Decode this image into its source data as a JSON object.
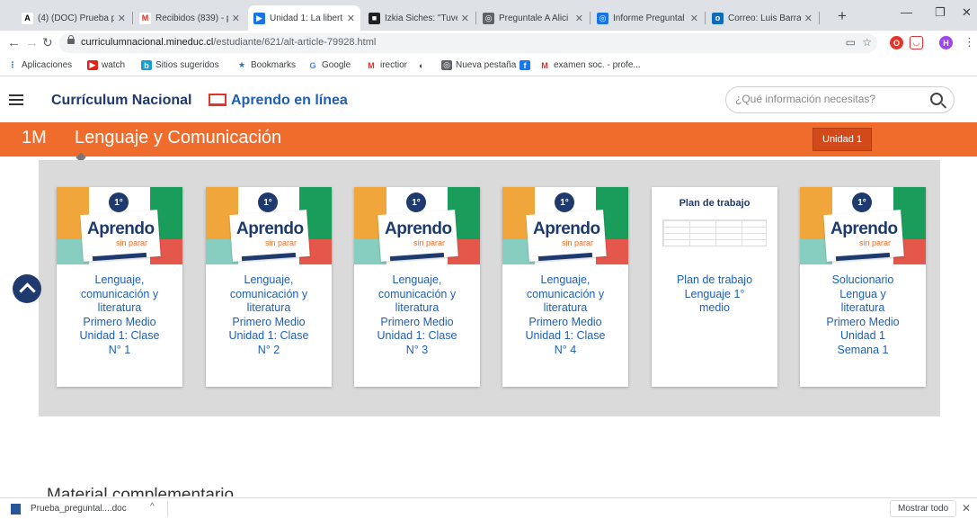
{
  "browser": {
    "tabs": [
      {
        "title": "(4) (DOC) Prueba p",
        "fav": "A",
        "fav_bg": "#ffffff",
        "fav_color": "#000000"
      },
      {
        "title": "Recibidos (839) - p",
        "fav": "M",
        "fav_bg": "#ffffff",
        "fav_color": "#d93025"
      },
      {
        "title": "Unidad 1: La libert",
        "fav": "▶",
        "fav_bg": "#1a73e8",
        "fav_color": "#ffffff"
      },
      {
        "title": "Izkia Siches: \"Tuve",
        "fav": "■",
        "fav_bg": "#202124",
        "fav_color": "#ffffff"
      },
      {
        "title": "Preguntale A Alici",
        "fav": "◎",
        "fav_bg": "#5f6368",
        "fav_color": "#ffffff"
      },
      {
        "title": "Informe Preguntal",
        "fav": "◎",
        "fav_bg": "#1a73e8",
        "fav_color": "#ffffff"
      },
      {
        "title": "Correo: Luis Barra",
        "fav": "o",
        "fav_bg": "#0f6cbd",
        "fav_color": "#ffffff"
      }
    ],
    "url_host": "curriculumnacional.mineduc.cl",
    "url_path": "/estudiante/621/alt-article-79928.html",
    "profile_initial": "H",
    "bookmarks": [
      {
        "label": "Aplicaciones",
        "icon": "⋮",
        "bg": "#ffffff",
        "color": "#1a73e8"
      },
      {
        "label": "watch",
        "icon": "▶",
        "bg": "#e62117",
        "color": "#ffffff"
      },
      {
        "label": "Sitios sugeridos",
        "icon": "b",
        "bg": "#1d9bd7",
        "color": "#ffffff"
      },
      {
        "label": "Bookmarks",
        "icon": "★",
        "bg": "#ffffff",
        "color": "#1a73e8"
      },
      {
        "label": "Google",
        "icon": "G",
        "bg": "#ffffff",
        "color": "#4285f4"
      },
      {
        "label": "irectior",
        "icon": "M",
        "bg": "#ffffff",
        "color": "#d93025"
      },
      {
        "label": "",
        "icon": "◐",
        "bg": "#ffffff",
        "color": "#333333"
      },
      {
        "label": "Nueva pestaña",
        "icon": "◎",
        "bg": "#5f6368",
        "color": "#ffffff"
      },
      {
        "label": "",
        "icon": "f",
        "bg": "#1877f2",
        "color": "#ffffff"
      },
      {
        "label": "examen soc. - profe...",
        "icon": "M",
        "bg": "#ffffff",
        "color": "#d93025"
      }
    ]
  },
  "header": {
    "brand": "Currículum Nacional",
    "aprendo": "Aprendo en línea",
    "search_placeholder": "¿Qué información necesitas?"
  },
  "subject_bar": {
    "level": "1M",
    "subject": "Lenguaje y Comunicación",
    "unit": "Unidad 1"
  },
  "cover": {
    "word": "Aprendo",
    "sub": "sin parar",
    "badge": "1°",
    "plan_title": "Plan de trabajo"
  },
  "cards": [
    {
      "kind": "aprendo",
      "lines": [
        "Lenguaje,",
        "comunicación y",
        "literatura",
        "Primero Medio",
        "Unidad 1: Clase",
        "N° 1"
      ]
    },
    {
      "kind": "aprendo",
      "lines": [
        "Lenguaje,",
        "comunicación y",
        "literatura",
        "Primero Medio",
        "Unidad 1: Clase",
        "N° 2"
      ]
    },
    {
      "kind": "aprendo",
      "lines": [
        "Lenguaje,",
        "comunicación y",
        "literatura",
        "Primero Medio",
        "Unidad 1: Clase",
        "N° 3"
      ]
    },
    {
      "kind": "aprendo",
      "lines": [
        "Lenguaje,",
        "comunicación y",
        "literatura",
        "Primero Medio",
        "Unidad 1: Clase",
        "N° 4"
      ]
    },
    {
      "kind": "plan",
      "lines": [
        "Plan de trabajo",
        "Lenguaje 1°",
        "medio"
      ]
    },
    {
      "kind": "aprendo",
      "lines": [
        "Solucionario",
        "Lengua y",
        "literatura",
        "Primero Medio",
        "Unidad 1",
        "Semana 1"
      ]
    }
  ],
  "section": {
    "heading": "Material complementario"
  },
  "downloads": {
    "file_name": "Prueba_preguntal....doc",
    "show_all": "Mostrar todo"
  }
}
